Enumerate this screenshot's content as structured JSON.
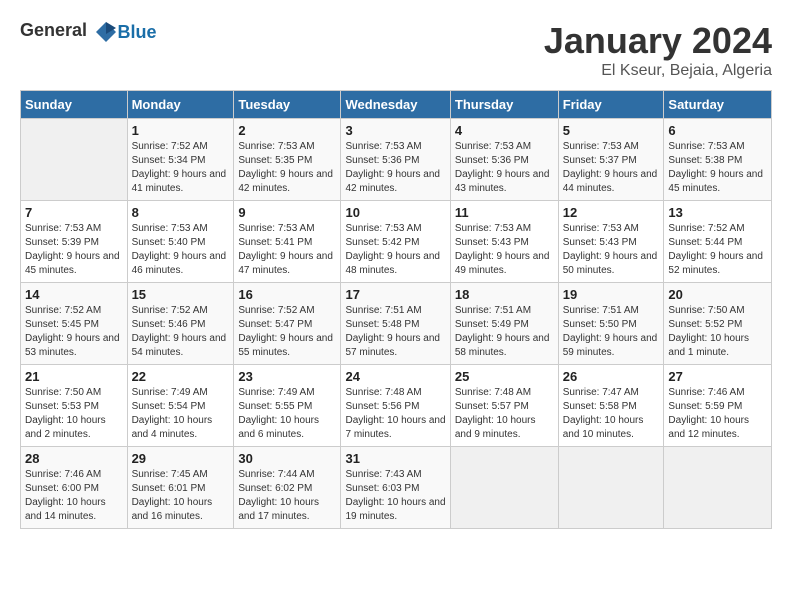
{
  "logo": {
    "general": "General",
    "blue": "Blue"
  },
  "calendar": {
    "title": "January 2024",
    "subtitle": "El Kseur, Bejaia, Algeria"
  },
  "weekdays": [
    "Sunday",
    "Monday",
    "Tuesday",
    "Wednesday",
    "Thursday",
    "Friday",
    "Saturday"
  ],
  "weeks": [
    [
      {
        "day": "",
        "sunrise": "",
        "sunset": "",
        "daylight": ""
      },
      {
        "day": "1",
        "sunrise": "Sunrise: 7:52 AM",
        "sunset": "Sunset: 5:34 PM",
        "daylight": "Daylight: 9 hours and 41 minutes."
      },
      {
        "day": "2",
        "sunrise": "Sunrise: 7:53 AM",
        "sunset": "Sunset: 5:35 PM",
        "daylight": "Daylight: 9 hours and 42 minutes."
      },
      {
        "day": "3",
        "sunrise": "Sunrise: 7:53 AM",
        "sunset": "Sunset: 5:36 PM",
        "daylight": "Daylight: 9 hours and 42 minutes."
      },
      {
        "day": "4",
        "sunrise": "Sunrise: 7:53 AM",
        "sunset": "Sunset: 5:36 PM",
        "daylight": "Daylight: 9 hours and 43 minutes."
      },
      {
        "day": "5",
        "sunrise": "Sunrise: 7:53 AM",
        "sunset": "Sunset: 5:37 PM",
        "daylight": "Daylight: 9 hours and 44 minutes."
      },
      {
        "day": "6",
        "sunrise": "Sunrise: 7:53 AM",
        "sunset": "Sunset: 5:38 PM",
        "daylight": "Daylight: 9 hours and 45 minutes."
      }
    ],
    [
      {
        "day": "7",
        "sunrise": "Sunrise: 7:53 AM",
        "sunset": "Sunset: 5:39 PM",
        "daylight": "Daylight: 9 hours and 45 minutes."
      },
      {
        "day": "8",
        "sunrise": "Sunrise: 7:53 AM",
        "sunset": "Sunset: 5:40 PM",
        "daylight": "Daylight: 9 hours and 46 minutes."
      },
      {
        "day": "9",
        "sunrise": "Sunrise: 7:53 AM",
        "sunset": "Sunset: 5:41 PM",
        "daylight": "Daylight: 9 hours and 47 minutes."
      },
      {
        "day": "10",
        "sunrise": "Sunrise: 7:53 AM",
        "sunset": "Sunset: 5:42 PM",
        "daylight": "Daylight: 9 hours and 48 minutes."
      },
      {
        "day": "11",
        "sunrise": "Sunrise: 7:53 AM",
        "sunset": "Sunset: 5:43 PM",
        "daylight": "Daylight: 9 hours and 49 minutes."
      },
      {
        "day": "12",
        "sunrise": "Sunrise: 7:53 AM",
        "sunset": "Sunset: 5:43 PM",
        "daylight": "Daylight: 9 hours and 50 minutes."
      },
      {
        "day": "13",
        "sunrise": "Sunrise: 7:52 AM",
        "sunset": "Sunset: 5:44 PM",
        "daylight": "Daylight: 9 hours and 52 minutes."
      }
    ],
    [
      {
        "day": "14",
        "sunrise": "Sunrise: 7:52 AM",
        "sunset": "Sunset: 5:45 PM",
        "daylight": "Daylight: 9 hours and 53 minutes."
      },
      {
        "day": "15",
        "sunrise": "Sunrise: 7:52 AM",
        "sunset": "Sunset: 5:46 PM",
        "daylight": "Daylight: 9 hours and 54 minutes."
      },
      {
        "day": "16",
        "sunrise": "Sunrise: 7:52 AM",
        "sunset": "Sunset: 5:47 PM",
        "daylight": "Daylight: 9 hours and 55 minutes."
      },
      {
        "day": "17",
        "sunrise": "Sunrise: 7:51 AM",
        "sunset": "Sunset: 5:48 PM",
        "daylight": "Daylight: 9 hours and 57 minutes."
      },
      {
        "day": "18",
        "sunrise": "Sunrise: 7:51 AM",
        "sunset": "Sunset: 5:49 PM",
        "daylight": "Daylight: 9 hours and 58 minutes."
      },
      {
        "day": "19",
        "sunrise": "Sunrise: 7:51 AM",
        "sunset": "Sunset: 5:50 PM",
        "daylight": "Daylight: 9 hours and 59 minutes."
      },
      {
        "day": "20",
        "sunrise": "Sunrise: 7:50 AM",
        "sunset": "Sunset: 5:52 PM",
        "daylight": "Daylight: 10 hours and 1 minute."
      }
    ],
    [
      {
        "day": "21",
        "sunrise": "Sunrise: 7:50 AM",
        "sunset": "Sunset: 5:53 PM",
        "daylight": "Daylight: 10 hours and 2 minutes."
      },
      {
        "day": "22",
        "sunrise": "Sunrise: 7:49 AM",
        "sunset": "Sunset: 5:54 PM",
        "daylight": "Daylight: 10 hours and 4 minutes."
      },
      {
        "day": "23",
        "sunrise": "Sunrise: 7:49 AM",
        "sunset": "Sunset: 5:55 PM",
        "daylight": "Daylight: 10 hours and 6 minutes."
      },
      {
        "day": "24",
        "sunrise": "Sunrise: 7:48 AM",
        "sunset": "Sunset: 5:56 PM",
        "daylight": "Daylight: 10 hours and 7 minutes."
      },
      {
        "day": "25",
        "sunrise": "Sunrise: 7:48 AM",
        "sunset": "Sunset: 5:57 PM",
        "daylight": "Daylight: 10 hours and 9 minutes."
      },
      {
        "day": "26",
        "sunrise": "Sunrise: 7:47 AM",
        "sunset": "Sunset: 5:58 PM",
        "daylight": "Daylight: 10 hours and 10 minutes."
      },
      {
        "day": "27",
        "sunrise": "Sunrise: 7:46 AM",
        "sunset": "Sunset: 5:59 PM",
        "daylight": "Daylight: 10 hours and 12 minutes."
      }
    ],
    [
      {
        "day": "28",
        "sunrise": "Sunrise: 7:46 AM",
        "sunset": "Sunset: 6:00 PM",
        "daylight": "Daylight: 10 hours and 14 minutes."
      },
      {
        "day": "29",
        "sunrise": "Sunrise: 7:45 AM",
        "sunset": "Sunset: 6:01 PM",
        "daylight": "Daylight: 10 hours and 16 minutes."
      },
      {
        "day": "30",
        "sunrise": "Sunrise: 7:44 AM",
        "sunset": "Sunset: 6:02 PM",
        "daylight": "Daylight: 10 hours and 17 minutes."
      },
      {
        "day": "31",
        "sunrise": "Sunrise: 7:43 AM",
        "sunset": "Sunset: 6:03 PM",
        "daylight": "Daylight: 10 hours and 19 minutes."
      },
      {
        "day": "",
        "sunrise": "",
        "sunset": "",
        "daylight": ""
      },
      {
        "day": "",
        "sunrise": "",
        "sunset": "",
        "daylight": ""
      },
      {
        "day": "",
        "sunrise": "",
        "sunset": "",
        "daylight": ""
      }
    ]
  ]
}
